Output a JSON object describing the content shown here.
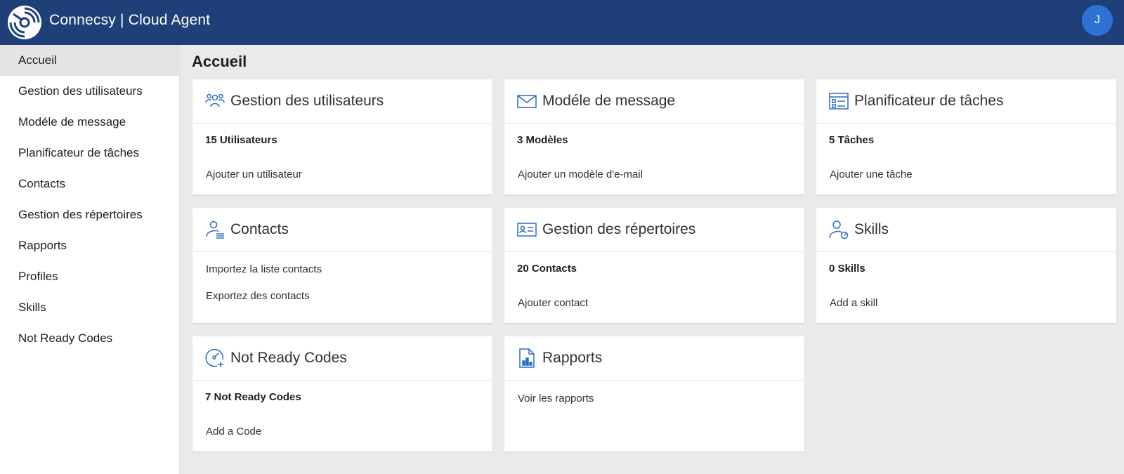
{
  "app": {
    "title": "Connecsy | Cloud Agent",
    "avatar_initial": "J"
  },
  "colors": {
    "header": "#1f3f78",
    "accent": "#2f72d6",
    "icon": "#2b6cc4",
    "background": "#ebeae9"
  },
  "sidebar": {
    "items": [
      {
        "label": "Accueil",
        "active": true
      },
      {
        "label": "Gestion des utilisateurs"
      },
      {
        "label": "Modéle de message"
      },
      {
        "label": "Planificateur de tâches"
      },
      {
        "label": "Contacts"
      },
      {
        "label": "Gestion des répertoires"
      },
      {
        "label": "Rapports"
      },
      {
        "label": "Profiles"
      },
      {
        "label": "Skills"
      },
      {
        "label": "Not Ready Codes"
      }
    ]
  },
  "main": {
    "title": "Accueil",
    "cards": [
      {
        "icon": "users-icon",
        "title": "Gestion des utilisateurs",
        "count": "15 Utilisateurs",
        "links": [
          "Ajouter un utilisateur"
        ]
      },
      {
        "icon": "mail-icon",
        "title": "Modéle de message",
        "count": "3 Modèles",
        "links": [
          "Ajouter un modèle d'e-mail"
        ]
      },
      {
        "icon": "task-list-icon",
        "title": "Planificateur de tâches",
        "count": "5 Tâches",
        "links": [
          "Ajouter une tâche"
        ]
      },
      {
        "icon": "contacts-icon",
        "title": "Contacts",
        "count": "",
        "links": [
          "Importez la liste contacts",
          "Exportez des contacts"
        ]
      },
      {
        "icon": "contact-card-icon",
        "title": "Gestion des répertoires",
        "count": "20 Contacts",
        "links": [
          "Ajouter contact"
        ]
      },
      {
        "icon": "skill-person-icon",
        "title": "Skills",
        "count": "0 Skills",
        "links": [
          "Add a skill"
        ]
      },
      {
        "icon": "gauge-add-icon",
        "title": "Not Ready Codes",
        "count": "7 Not Ready Codes",
        "links": [
          "Add a Code"
        ]
      },
      {
        "icon": "report-icon",
        "title": "Rapports",
        "count": "",
        "links": [
          "Voir les rapports"
        ]
      }
    ]
  }
}
